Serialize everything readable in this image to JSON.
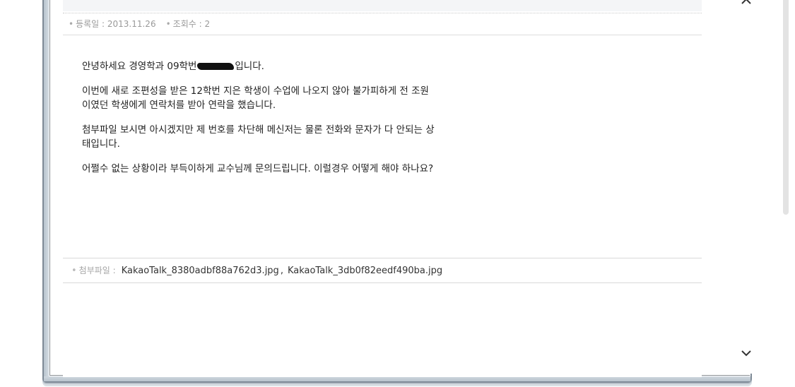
{
  "post": {
    "meta": {
      "date_label": "등록일 : 2013.11.26",
      "views_label": "조회수 : 2"
    },
    "body": {
      "p1_before": "안녕하세요 경영학과 09학번",
      "p1_after": "입니다.",
      "p2_line1": "이번에 새로 조편성을 받은 12학번   지은 학생이 수업에 나오지 않아 불가피하게 전 조원",
      "p2_line2": "이였던 학생에게 연락처를 받아 연락을 했습니다.",
      "p3_line1": "첨부파일 보시면 아시겠지만 제 번호를 차단해 메신저는 물론 전화와 문자가 다 안되는 상",
      "p3_line2": "태입니다.",
      "p4_line1": "어쩔수 없는 상황이라 부득이하게 교수님께 문의드립니다. 이럴경우 어떻게 해야 하나요?"
    },
    "attachments": {
      "label": "첨부파일 :",
      "files": [
        "KakaoTalk_8380adbf88a762d3.jpg",
        "KakaoTalk_3db0f82eedf490ba.jpg"
      ],
      "separator": ","
    }
  },
  "scrollbar": {
    "up_icon": "chevron-up-icon",
    "down_icon": "chevron-down-icon"
  }
}
